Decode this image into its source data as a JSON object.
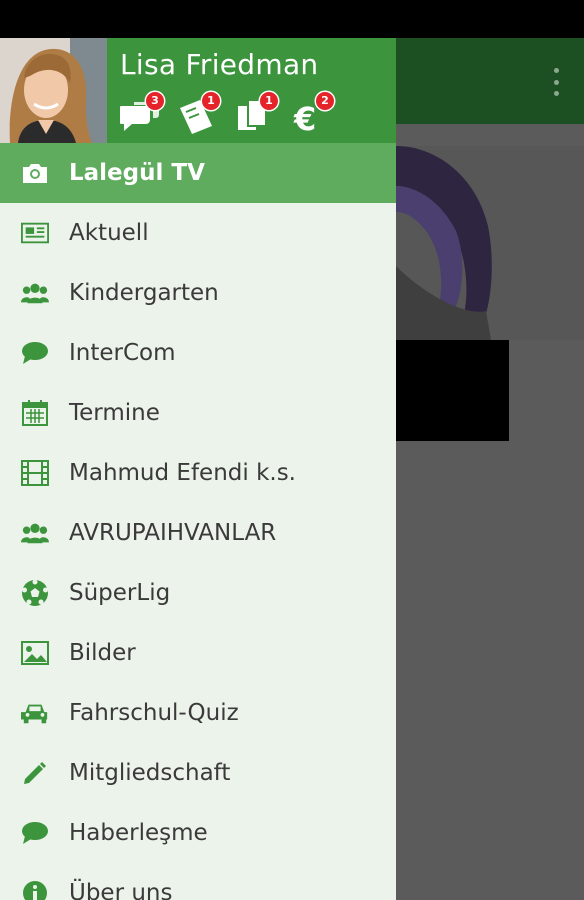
{
  "user": {
    "name": "Lisa Friedman"
  },
  "header_badges": [
    {
      "icon": "chat-icon",
      "count": "3"
    },
    {
      "icon": "ticket-icon",
      "count": "1"
    },
    {
      "icon": "copy-icon",
      "count": "1"
    },
    {
      "icon": "euro-icon",
      "count": "2"
    }
  ],
  "menu": {
    "items": [
      {
        "label": "Lalegül TV",
        "icon": "camera-icon",
        "active": true
      },
      {
        "label": "Aktuell",
        "icon": "newspaper-icon"
      },
      {
        "label": "Kindergarten",
        "icon": "group-icon"
      },
      {
        "label": "InterCom",
        "icon": "chat-bubble-icon"
      },
      {
        "label": "Termine",
        "icon": "calendar-icon"
      },
      {
        "label": "Mahmud Efendi k.s.",
        "icon": "film-icon"
      },
      {
        "label": "AVRUPAIHVANLAR",
        "icon": "group-icon"
      },
      {
        "label": "SüperLig",
        "icon": "soccer-ball-icon"
      },
      {
        "label": "Bilder",
        "icon": "image-icon"
      },
      {
        "label": "Fahrschul-Quiz",
        "icon": "car-icon"
      },
      {
        "label": "Mitgliedschaft",
        "icon": "pencil-icon"
      },
      {
        "label": "Haberleşme",
        "icon": "chat-bubble-icon"
      },
      {
        "label": "Über uns",
        "icon": "info-icon"
      }
    ]
  },
  "colors": {
    "header_green": "#3c953d",
    "active_item": "#5fac5e",
    "icon_green": "#3c953d",
    "badge_red": "#e4232a",
    "drawer_bg": "#ecf3ea"
  }
}
